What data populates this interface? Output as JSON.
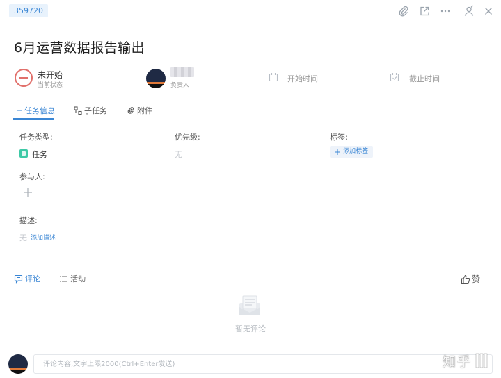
{
  "header": {
    "task_id": "359720",
    "icons": [
      "paperclip-icon",
      "open-external-icon",
      "more-icon",
      "user-pin-icon",
      "close-icon"
    ]
  },
  "task": {
    "title": "6月运营数据报告输出"
  },
  "meta": {
    "status_value": "未开始",
    "status_label": "当前状态",
    "owner_label": "负责人",
    "start_time": "开始时间",
    "deadline": "截止时间"
  },
  "tabs": [
    {
      "label": "任务信息",
      "icon": "list-icon",
      "active": true
    },
    {
      "label": "子任务",
      "icon": "subtask-icon",
      "active": false
    },
    {
      "label": "附件",
      "icon": "paperclip-icon",
      "active": false
    }
  ],
  "fields": {
    "task_type_label": "任务类型:",
    "task_type_value": "任务",
    "priority_label": "优先级:",
    "priority_value": "无",
    "tags_label": "标签:",
    "add_tag": "添加标签",
    "participants_label": "参与人:",
    "description_label": "描述:",
    "description_value": "无",
    "add_description": "添加描述"
  },
  "comments": {
    "tabs": [
      {
        "label": "评论",
        "icon": "comment-icon",
        "active": true
      },
      {
        "label": "活动",
        "icon": "activity-list-icon",
        "active": false
      }
    ],
    "like_label": "赞",
    "empty_text": "暂无评论",
    "input_placeholder": "评论内容,文字上限2000(Ctrl+Enter发送)",
    "input_value": ""
  },
  "watermark": {
    "text": "知乎"
  },
  "colors": {
    "accent": "#3a86d4",
    "status": "#e1706b",
    "task_type": "#3ec9a6"
  }
}
